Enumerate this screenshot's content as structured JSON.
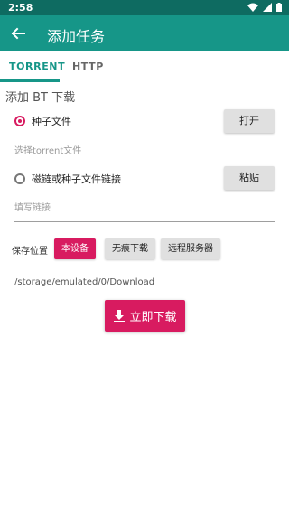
{
  "status_bar": {
    "time": "2:58",
    "icons": [
      "wifi-icon",
      "signal-icon",
      "battery-icon"
    ]
  },
  "app_bar": {
    "title": "添加任务",
    "back_icon": "arrow-left-icon"
  },
  "tabs": [
    {
      "label": "TORRENT",
      "active": true
    },
    {
      "label": "HTTP",
      "active": false
    }
  ],
  "section": {
    "title": "添加 BT 下载"
  },
  "torrent_option": {
    "label": "种子文件",
    "checked": true,
    "hint": "选择torrent文件",
    "button_label": "打开"
  },
  "magnet_option": {
    "label": "磁链或种子文件链接",
    "checked": false,
    "placeholder": "填写链接",
    "button_label": "粘贴"
  },
  "save_location": {
    "label": "保存位置",
    "options": [
      {
        "label": "本设备",
        "selected": true
      },
      {
        "label": "无痕下载",
        "selected": false
      },
      {
        "label": "远程服务器",
        "selected": false
      }
    ],
    "path": "/storage/emulated/0/Download"
  },
  "download_button": {
    "label": "立即下载",
    "icon": "download-icon"
  },
  "colors": {
    "primary": "#169688",
    "primary_dark": "#0e6b61",
    "accent": "#d81b60"
  }
}
